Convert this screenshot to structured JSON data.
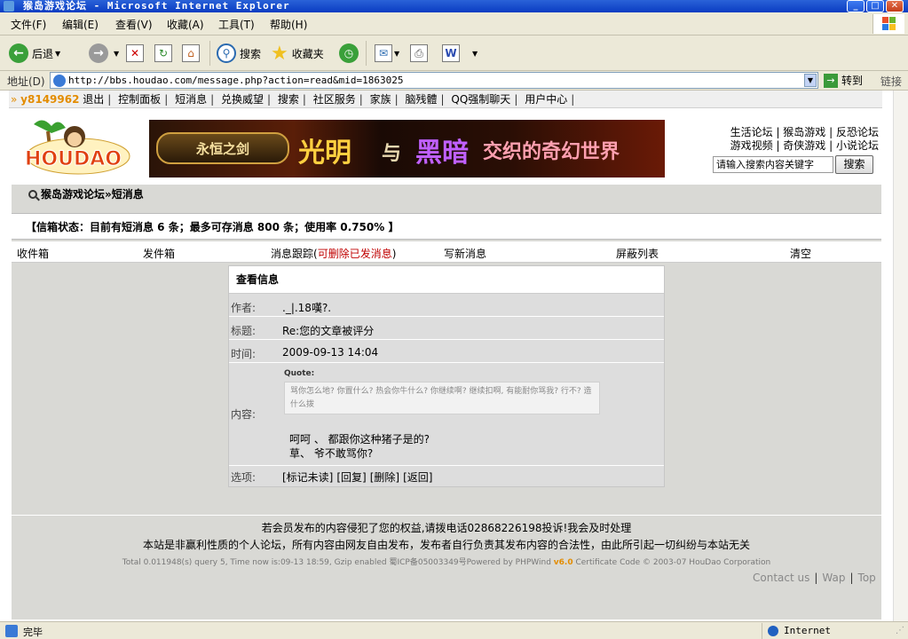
{
  "window": {
    "title": "猴岛游戏论坛 - Microsoft Internet Explorer",
    "minimize": "_",
    "maximize": "□",
    "close": "✕"
  },
  "menubar": {
    "items": [
      "文件(F)",
      "编辑(E)",
      "查看(V)",
      "收藏(A)",
      "工具(T)",
      "帮助(H)"
    ]
  },
  "toolbar": {
    "back": "后退",
    "search": "搜索",
    "favorites": "收藏夹"
  },
  "address": {
    "label": "地址(D)",
    "url": "http://bbs.houdao.com/message.php?action=read&mid=1863025",
    "go": "转到",
    "links": "链接"
  },
  "forum_nav": {
    "username": "y8149962",
    "items": [
      "退出",
      "控制面板",
      "短消息",
      "兑换威望",
      "搜索",
      "社区服务",
      "家族",
      "脑残體",
      "QQ强制聊天",
      "用户中心"
    ]
  },
  "banner": {
    "tag": "永恒之剑",
    "light": "光明",
    "and": "与",
    "dark": "黑暗",
    "rest": "交织的奇幻世界"
  },
  "top_links": {
    "row1": [
      "生活论坛",
      "猴岛游戏",
      "反恐论坛"
    ],
    "row2": [
      "游戏视频",
      "奇侠游戏",
      "小说论坛"
    ]
  },
  "search": {
    "placeholder": "请输入搜索内容关键字",
    "button": "搜索"
  },
  "breadcrumb": {
    "home": "猴岛游戏论坛",
    "current": "»短消息"
  },
  "mailbox_status": "【信箱状态：目前有短消息 6 条；最多可存消息 800 条；使用率 0.750% 】",
  "tabs": {
    "inbox": "收件箱",
    "sent": "发件箱",
    "tracking": "消息跟踪",
    "tracking_red": "可删除已发消息",
    "compose": "写新消息",
    "blocklist": "屏蔽列表",
    "clear": "清空"
  },
  "message": {
    "header": "查看信息",
    "author_label": "作者:",
    "author": "._|.18嘆?.",
    "subject_label": "标题:",
    "subject": "Re:您的文章被评分",
    "time_label": "时间:",
    "time": "2009-09-13 14:04",
    "content_label": "内容:",
    "quote_label": "Quote:",
    "quote_text": "骂你怎么地? 你置什么? 热会你牛什么? 你继续啊? 继续扣啊, 有能耐你骂我? 行不? 造什么拨",
    "reply_line1": "呵呵 、 都跟你这种猪子是的?",
    "reply_line2": "草、 爷不敢骂你?",
    "options_label": "选项:",
    "actions": [
      "[标记未读]",
      "[回复]",
      "[删除]",
      "[返回]"
    ]
  },
  "footer": {
    "line1": "若会员发布的内容侵犯了您的权益,请拨电话02868226198投诉!我会及时处理",
    "line2": "本站是非赢利性质的个人论坛，所有内容由网友自由发布，发布者自行负责其发布内容的合法性，由此所引起一切纠纷与本站无关",
    "line3_pre": "Total 0.011948(s) query 5, Time now is:09-13 18:59, Gzip enabled 蜀ICP备05003349号Powered by PHPWind ",
    "line3_ver": "v6.0",
    "line3_post": " Certificate Code © 2003-07 HouDao Corporation",
    "links": [
      "Contact us",
      "Wap",
      "Top"
    ]
  },
  "statusbar": {
    "text": "完毕",
    "zone": "Internet"
  },
  "colors": {
    "username": "#e38c00",
    "red_link": "#c00000",
    "grey_band": "#d9d9d5",
    "xp_title": "#0a3cc2"
  }
}
